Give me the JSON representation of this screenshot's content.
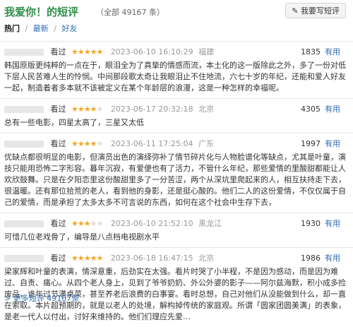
{
  "page": {
    "title": "我爱你！的短评",
    "subtitle": "（全部 49167 条）",
    "write_button": "我要写短评",
    "tabs": [
      {
        "label": "热门"
      },
      {
        "label": "最新"
      },
      {
        "label": "好友"
      }
    ],
    "footer_link": "> 更多短评 49167条"
  },
  "reviews": [
    {
      "seen": "看过",
      "stars": "★★★★★",
      "stars_off": "",
      "time": "2023-06-10 16:10:29",
      "location": "福建",
      "votes": "1835",
      "useful": "有用",
      "content": "韩国原版更纯粹的一点在于，眼泪全为了真挚的情感而流，本土化的这一版除此之外，多了一份对低下层人民苦难人生的怜悯。中间那段歌太奇让我眼泪止不住地流，六七十岁的年纪，还能和爱人好友一起，制造着者多本就不该被定义在某个年龄层的浪漫，这是一种怎样的幸福呢。"
    },
    {
      "seen": "看过",
      "stars": "★★★★",
      "stars_off": "★",
      "time": "2023-06-17 20:32:18",
      "location": "北京",
      "votes": "4305",
      "useful": "有用",
      "content": "总有一些电影，四星太高了，三星又太低"
    },
    {
      "seen": "看过",
      "stars": "★★★★",
      "stars_off": "★",
      "time": "2023-06-11 17:25:04",
      "location": "广东",
      "votes": "1997",
      "useful": "有用",
      "content": "优缺点都很明显的电影，但演员出色的演绎弥补了情节碎片化与人物脸谱化等缺点，尤其是叶童，演技只能用恐怖二字形容。暮年沉寂，有爱便也有了活力，不管什么年纪，那些爱情的里酸甜都能让人欢欣鼓舞。只是在夕阳恋里这份酸甜里多了一分苦涩，两个从深坑里爬起来的人，相互扶持走下去，很温暖。还有那位拾荒的老人，看到他的身影，还是挺心酸的。他们二人的这份爱情，不仅仅属于自己的爱情，而是承担了太多太多不可言说的东西，如何在这个社会中生存下去，"
    },
    {
      "seen": "看过",
      "stars": "★★★",
      "stars_off": "★★",
      "time": "2023-06-10 21:52:10",
      "location": "黑龙江",
      "votes": "1930",
      "useful": "有用",
      "content": "可惜几位老戏骨了，编导是八点档电视剧水平"
    },
    {
      "seen": "看过",
      "stars": "★★★★★",
      "stars_off": "",
      "time": "2023-06-18 16:47:15",
      "location": "北京",
      "votes": "1986",
      "useful": "有用",
      "content": "梁家辉和叶童的表演，情深意重，后劲实在太强。看片时哭了小半程，不是因为感动，而是因为难过、自责、痛心。从四个老人身上，见到了爷爷奶奶、外公外婆的影子——阿尔兹海默，积小成多捡废品，谁年过节满桌菜，甚至养老后浪费的白事宴。看时总想，自己对他们从没能做到什么，却一直在索取。本片超预期的，就是以老人的处境，解构掉传统的家庭观。所谓「圆家团圆美满」的表象，是老一代人以付出，讨好来维持的。他们们理应先爱…"
    }
  ]
}
